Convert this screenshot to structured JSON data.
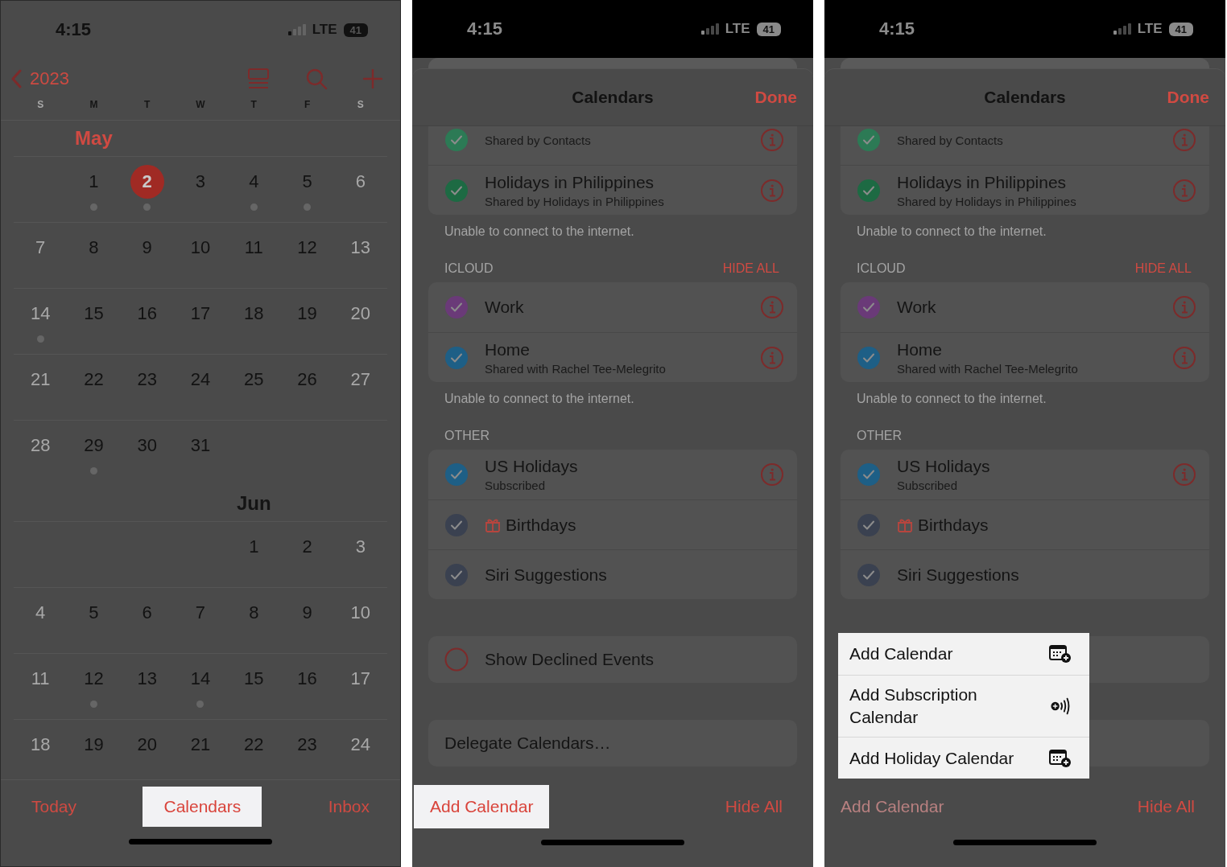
{
  "panels": [
    {
      "kind": "month",
      "status": {
        "time": "4:15",
        "network": "LTE",
        "battery": "41"
      },
      "nav": {
        "back": "2023"
      },
      "weekdays": [
        "S",
        "M",
        "T",
        "W",
        "T",
        "F",
        "S"
      ],
      "months": [
        {
          "name": "May",
          "weeks": [
            [
              {
                "day": "1",
                "event": true,
                "today": false
              },
              {
                "day": "2",
                "event": true,
                "today": true
              },
              {
                "day": "3",
                "event": false,
                "today": false
              },
              {
                "day": "4",
                "event": true,
                "today": false
              },
              {
                "day": "5",
                "event": true,
                "today": false
              },
              {
                "day": "6",
                "event": false,
                "today": false
              }
            ],
            [
              {
                "day": "7",
                "event": false,
                "today": false
              },
              {
                "day": "8",
                "event": false,
                "today": false
              },
              {
                "day": "9",
                "event": false,
                "today": false
              },
              {
                "day": "10",
                "event": false,
                "today": false
              },
              {
                "day": "11",
                "event": false,
                "today": false
              },
              {
                "day": "12",
                "event": false,
                "today": false
              },
              {
                "day": "13",
                "event": false,
                "today": false
              }
            ],
            [
              {
                "day": "14",
                "event": true,
                "today": false
              },
              {
                "day": "15",
                "event": false,
                "today": false
              },
              {
                "day": "16",
                "event": false,
                "today": false
              },
              {
                "day": "17",
                "event": false,
                "today": false
              },
              {
                "day": "18",
                "event": false,
                "today": false
              },
              {
                "day": "19",
                "event": false,
                "today": false
              },
              {
                "day": "20",
                "event": false,
                "today": false
              }
            ],
            [
              {
                "day": "21",
                "event": false,
                "today": false
              },
              {
                "day": "22",
                "event": false,
                "today": false
              },
              {
                "day": "23",
                "event": false,
                "today": false
              },
              {
                "day": "24",
                "event": false,
                "today": false
              },
              {
                "day": "25",
                "event": false,
                "today": false
              },
              {
                "day": "26",
                "event": false,
                "today": false
              },
              {
                "day": "27",
                "event": false,
                "today": false
              }
            ],
            [
              {
                "day": "28",
                "event": false,
                "today": false
              },
              {
                "day": "29",
                "event": true,
                "today": false
              },
              {
                "day": "30",
                "event": false,
                "today": false
              },
              {
                "day": "31",
                "event": false,
                "today": false
              }
            ]
          ]
        },
        {
          "name": "Jun",
          "weeks": [
            [
              {
                "day": "1",
                "event": false,
                "today": false
              },
              {
                "day": "2",
                "event": false,
                "today": false
              },
              {
                "day": "3",
                "event": false,
                "today": false
              }
            ],
            [
              {
                "day": "4",
                "event": false,
                "today": false
              },
              {
                "day": "5",
                "event": false,
                "today": false
              },
              {
                "day": "6",
                "event": false,
                "today": false
              },
              {
                "day": "7",
                "event": false,
                "today": false
              },
              {
                "day": "8",
                "event": false,
                "today": false
              },
              {
                "day": "9",
                "event": false,
                "today": false
              },
              {
                "day": "10",
                "event": false,
                "today": false
              }
            ],
            [
              {
                "day": "11",
                "event": false,
                "today": false
              },
              {
                "day": "12",
                "event": true,
                "today": false
              },
              {
                "day": "13",
                "event": false,
                "today": false
              },
              {
                "day": "14",
                "event": true,
                "today": false
              },
              {
                "day": "15",
                "event": false,
                "today": false
              },
              {
                "day": "16",
                "event": false,
                "today": false
              },
              {
                "day": "17",
                "event": false,
                "today": false
              }
            ],
            [
              {
                "day": "18",
                "event": false,
                "today": false
              },
              {
                "day": "19",
                "event": false,
                "today": false
              },
              {
                "day": "20",
                "event": false,
                "today": false
              },
              {
                "day": "21",
                "event": false,
                "today": false
              },
              {
                "day": "22",
                "event": false,
                "today": false
              },
              {
                "day": "23",
                "event": false,
                "today": false
              },
              {
                "day": "24",
                "event": false,
                "today": false
              }
            ]
          ]
        }
      ],
      "toolbar": [
        {
          "label": "Today",
          "highlighted": false
        },
        {
          "label": "Calendars",
          "highlighted": true
        },
        {
          "label": "Inbox",
          "highlighted": false
        }
      ]
    },
    {
      "kind": "list",
      "status": {
        "time": "4:15",
        "network": "LTE",
        "battery": "41"
      },
      "sheet": {
        "title": "Calendars",
        "done": "Done"
      },
      "sections": [
        {
          "kind": "group",
          "rows": [
            {
              "subtitle": "Shared by Contacts",
              "color": "#2c7a55",
              "checked": true,
              "gift": false,
              "info": true
            },
            {
              "title": "Holidays in Philippines",
              "subtitle": "Shared by Holidays in Philippines",
              "color": "#1d6a43",
              "checked": true,
              "gift": false,
              "info": true
            }
          ],
          "footer": "Unable to connect to the internet."
        },
        {
          "kind": "group",
          "header": "ICLOUD",
          "action": "HIDE ALL",
          "rows": [
            {
              "title": "Work",
              "color": "#6a3a78",
              "checked": true,
              "gift": false,
              "info": true
            },
            {
              "title": "Home",
              "subtitle": "Shared with Rachel Tee-Melegrito",
              "color": "#1e5f86",
              "checked": true,
              "gift": false,
              "info": true
            }
          ],
          "footer": "Unable to connect to the internet."
        },
        {
          "kind": "group",
          "header": "OTHER",
          "rows": [
            {
              "title": "US Holidays",
              "subtitle": "Subscribed",
              "color": "#1e5f86",
              "checked": true,
              "gift": false,
              "info": true
            },
            {
              "title": "Birthdays",
              "color": "#3a4150",
              "checked": true,
              "gift": true,
              "info": false
            },
            {
              "title": "Siri Suggestions",
              "color": "#3a4150",
              "checked": true,
              "gift": false,
              "info": false
            }
          ]
        },
        {
          "kind": "toggle",
          "label": "Show Declined Events",
          "checked": false
        },
        {
          "kind": "link",
          "label": "Delegate Calendars…"
        }
      ],
      "toolbar": [
        {
          "label": "Add Calendar",
          "highlighted": true,
          "disabled": false
        },
        {
          "label": "Hide All",
          "highlighted": false,
          "disabled": false
        }
      ]
    },
    {
      "kind": "list",
      "status": {
        "time": "4:15",
        "network": "LTE",
        "battery": "41"
      },
      "sheet": {
        "title": "Calendars",
        "done": "Done"
      },
      "sections": [
        {
          "kind": "group",
          "rows": [
            {
              "subtitle": "Shared by Contacts",
              "color": "#2c7a55",
              "checked": true,
              "gift": false,
              "info": true
            },
            {
              "title": "Holidays in Philippines",
              "subtitle": "Shared by Holidays in Philippines",
              "color": "#1d6a43",
              "checked": true,
              "gift": false,
              "info": true
            }
          ],
          "footer": "Unable to connect to the internet."
        },
        {
          "kind": "group",
          "header": "ICLOUD",
          "action": "HIDE ALL",
          "rows": [
            {
              "title": "Work",
              "color": "#6a3a78",
              "checked": true,
              "gift": false,
              "info": true
            },
            {
              "title": "Home",
              "subtitle": "Shared with Rachel Tee-Melegrito",
              "color": "#1e5f86",
              "checked": true,
              "gift": false,
              "info": true
            }
          ],
          "footer": "Unable to connect to the internet."
        },
        {
          "kind": "group",
          "header": "OTHER",
          "rows": [
            {
              "title": "US Holidays",
              "subtitle": "Subscribed",
              "color": "#1e5f86",
              "checked": true,
              "gift": false,
              "info": true
            },
            {
              "title": "Birthdays",
              "color": "#3a4150",
              "checked": true,
              "gift": true,
              "info": false
            },
            {
              "title": "Siri Suggestions",
              "color": "#3a4150",
              "checked": true,
              "gift": false,
              "info": false
            }
          ]
        },
        {
          "kind": "blank"
        },
        {
          "kind": "blank"
        }
      ],
      "toolbar": [
        {
          "label": "Add Calendar",
          "highlighted": false,
          "disabled": true
        },
        {
          "label": "Hide All",
          "highlighted": false,
          "disabled": false
        }
      ],
      "menu": [
        {
          "label": "Add Calendar",
          "kind": "calendar"
        },
        {
          "label": "Add Subscription Calendar",
          "kind": "subscription"
        },
        {
          "label": "Add Holiday Calendar",
          "kind": "calendar"
        }
      ]
    }
  ]
}
